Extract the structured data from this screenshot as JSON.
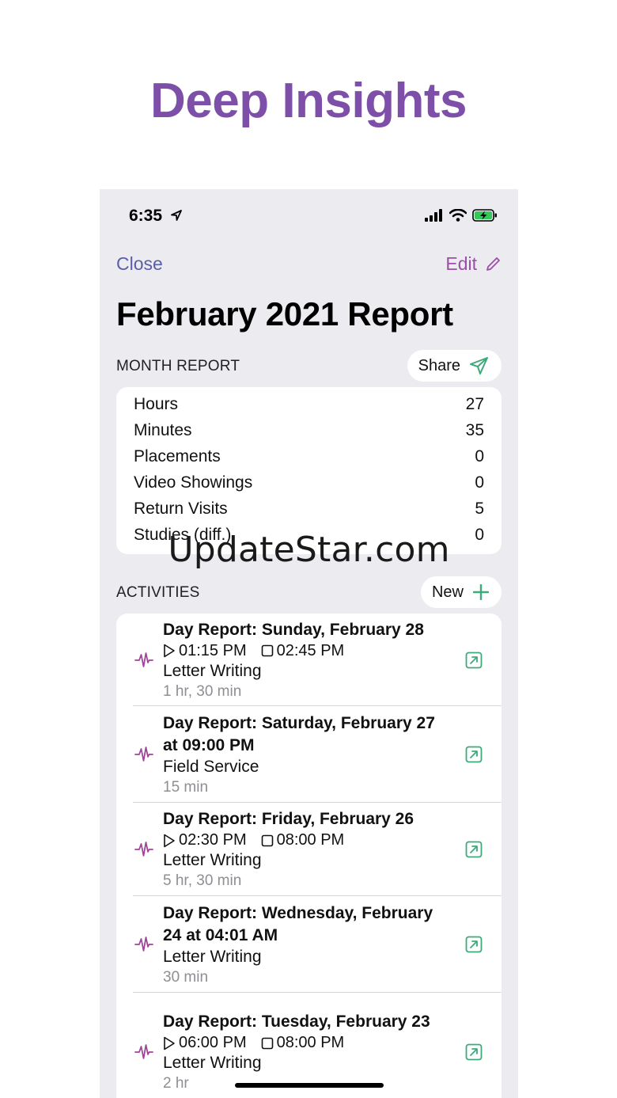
{
  "promo": {
    "headline": "Deep Insights"
  },
  "status_bar": {
    "time": "6:35",
    "icons": [
      "location-arrow-icon",
      "cellular-signal-icon",
      "wifi-icon",
      "battery-charging-icon"
    ]
  },
  "nav": {
    "close_label": "Close",
    "edit_label": "Edit",
    "edit_icon": "pencil-icon"
  },
  "page_title": "February 2021 Report",
  "month_report": {
    "section_label": "MONTH REPORT",
    "share_label": "Share",
    "share_icon": "paper-plane-icon",
    "rows": [
      {
        "label": "Hours",
        "value": "27"
      },
      {
        "label": "Minutes",
        "value": "35"
      },
      {
        "label": "Placements",
        "value": "0"
      },
      {
        "label": "Video Showings",
        "value": "0"
      },
      {
        "label": "Return Visits",
        "value": "5"
      },
      {
        "label": "Studies (diff.)",
        "value": "0"
      }
    ]
  },
  "watermark": "UpdateStar.com",
  "activities": {
    "section_label": "ACTIVITIES",
    "new_label": "New",
    "new_icon": "plus-icon",
    "items": [
      {
        "title": "Day Report: Sunday, February 28",
        "start": "01:15 PM",
        "end": "02:45 PM",
        "type": "Letter Writing",
        "duration": "1 hr, 30 min"
      },
      {
        "title": "Day Report: Saturday, February 27 at 09:00 PM",
        "type": "Field Service",
        "duration": "15 min"
      },
      {
        "title": "Day Report: Friday, February 26",
        "start": "02:30 PM",
        "end": "08:00 PM",
        "type": "Letter Writing",
        "duration": "5 hr, 30 min"
      },
      {
        "title": "Day Report: Wednesday, February 24 at 04:01 AM",
        "type": "Letter Writing",
        "duration": "30 min"
      },
      {
        "title": "Day Report: Tuesday, February 23",
        "start": "06:00 PM",
        "end": "08:00 PM",
        "type": "Letter Writing",
        "duration": "2 hr"
      }
    ]
  },
  "colors": {
    "accent_purple": "#7d4fa8",
    "close_blue": "#5a5fa8",
    "edit_magenta": "#9c4fa8",
    "link_green": "#3daa7a",
    "pulse_magenta": "#a0459a"
  }
}
